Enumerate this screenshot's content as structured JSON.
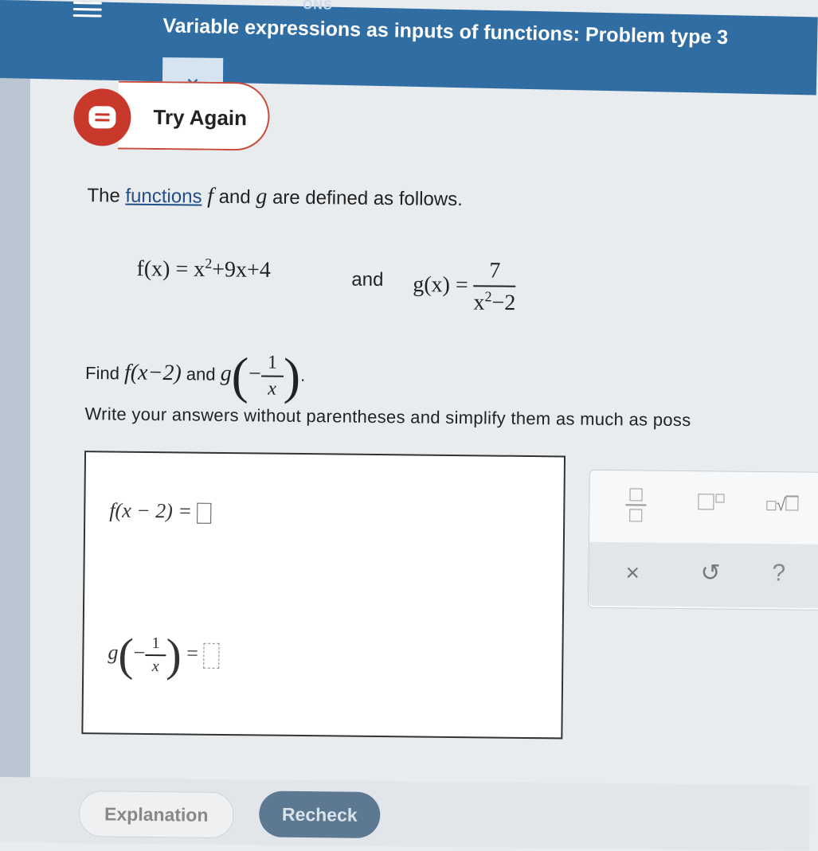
{
  "header": {
    "subtitle": "ONS",
    "title": "Variable expressions as inputs of functions: Problem type 3"
  },
  "status": {
    "label": "Try Again"
  },
  "problem": {
    "intro_prefix": "The",
    "intro_link": "functions",
    "intro_f": "f",
    "intro_mid": "and",
    "intro_g": "g",
    "intro_suffix": "are defined as follows.",
    "f_def_lhs": "f(x) = x",
    "f_def_exp": "2",
    "f_def_rhs": "+9x+4",
    "and_word": "and",
    "g_def_lhs": "g(x) =",
    "g_def_num": "7",
    "g_def_den_base": "x",
    "g_def_den_exp": "2",
    "g_def_den_rest": "−2",
    "find_prefix": "Find",
    "find_f": "f(x−2)",
    "find_and": "and",
    "find_g": "g",
    "find_g_sign": "−",
    "find_g_num": "1",
    "find_g_den": "x",
    "instructions": "Write your answers without parentheses and simplify them as much as poss"
  },
  "answers": {
    "f_label": "f(x − 2) =",
    "g_label": "g",
    "g_sign": "−",
    "g_num": "1",
    "g_den": "x",
    "g_eq": "="
  },
  "palette": {
    "fraction": "fraction-icon",
    "exponent": "exponent-icon",
    "root": "nth-root-icon",
    "clear": "×",
    "undo": "↺",
    "help": "?"
  },
  "buttons": {
    "explanation": "Explanation",
    "recheck": "Recheck"
  },
  "colors": {
    "header": "#2f6da3",
    "error": "#c8392b",
    "recheck": "#5d7891"
  }
}
